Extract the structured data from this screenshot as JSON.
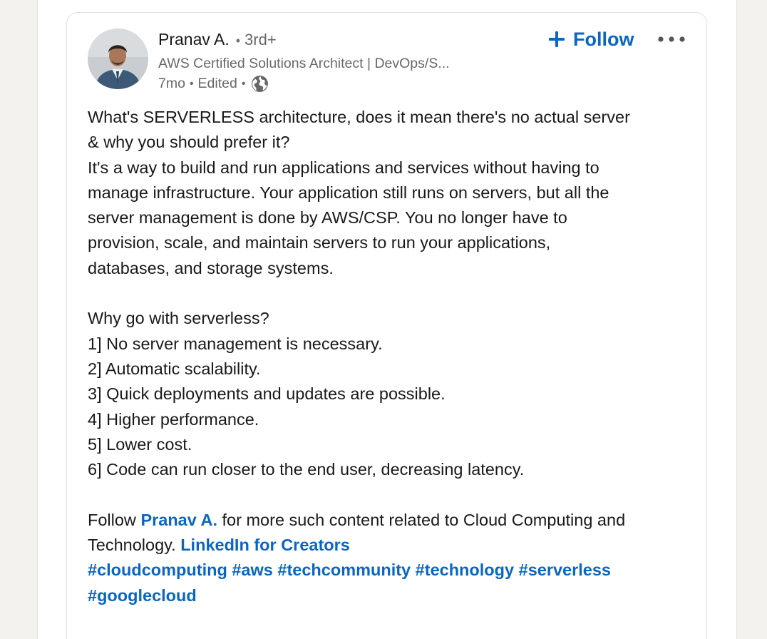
{
  "post": {
    "author": {
      "name": "Pranav A.",
      "degree": "3rd+",
      "headline": "AWS Certified Solutions Architect | DevOps/S...",
      "time": "7mo",
      "edited": "Edited",
      "visibility_icon": "globe-icon"
    },
    "actions": {
      "follow_label": "Follow",
      "follow_icon": "plus-icon",
      "more_icon": "ellipsis-icon"
    },
    "body": {
      "intro_lines": [
        "What's SERVERLESS architecture, does it mean there's no actual server",
        "& why you should prefer it?",
        "It's a way to build and run applications and services without having to",
        "manage infrastructure. Your application still runs on servers, but all the",
        "server management is done by AWS/CSP. You no longer have to",
        "provision, scale, and maintain servers to run your applications,",
        "databases, and storage systems."
      ],
      "why_heading": "Why go with serverless?",
      "reasons": [
        "1] No server management is necessary.",
        "2] Automatic scalability.",
        "3] Quick deployments and updates are possible.",
        "4] Higher performance.",
        "5] Lower cost.",
        "6] Code can run closer to the end user, decreasing latency."
      ],
      "cta_prefix": "Follow ",
      "cta_mention": "Pranav A.",
      "cta_suffix": " for more such content related to Cloud Computing and",
      "cta_line2_prefix": "Technology. ",
      "cta_page_link": "LinkedIn for Creators",
      "hashtags_line1": [
        "#cloudcomputing",
        "#aws",
        "#techcommunity",
        "#technology",
        "#serverless"
      ],
      "hashtags_line2": [
        "#googlecloud"
      ]
    }
  },
  "colors": {
    "link": "#0a66c2",
    "background": "#f4f2ee",
    "card": "#ffffff"
  }
}
